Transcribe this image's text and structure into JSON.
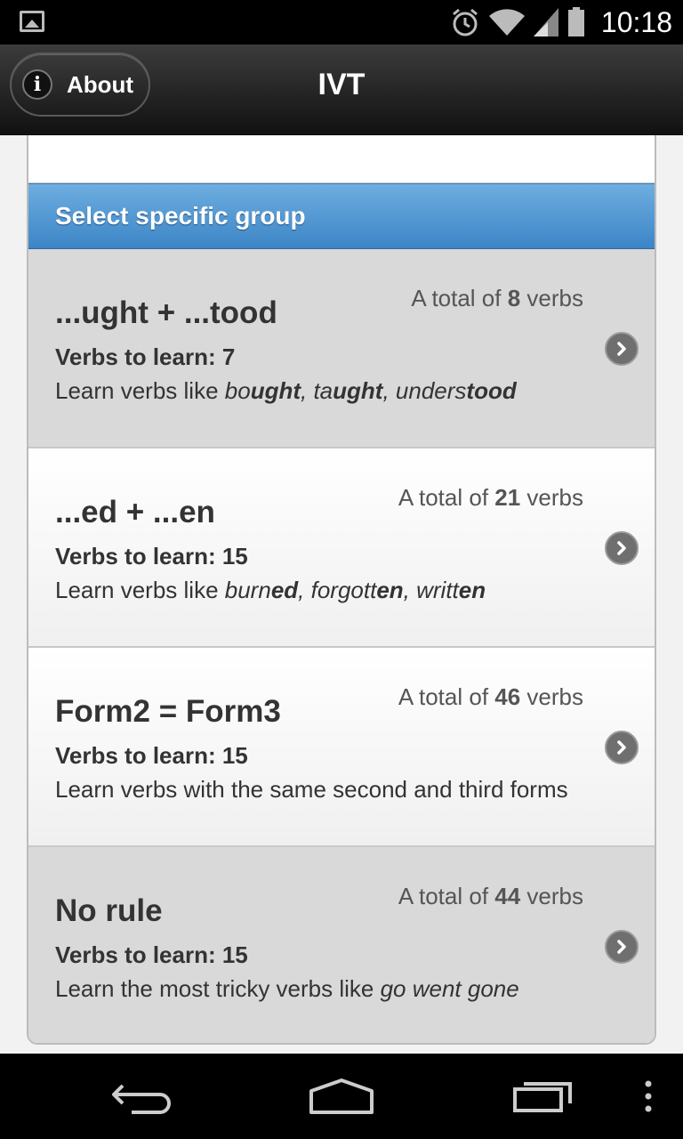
{
  "status_bar": {
    "time": "10:18",
    "icons": [
      "gallery-icon",
      "alarm-icon",
      "wifi-icon",
      "signal-icon",
      "battery-icon"
    ]
  },
  "header": {
    "about_label": "About",
    "about_icon": "info-icon",
    "title": "IVT"
  },
  "list": {
    "divider_label": "Select specific group",
    "items": [
      {
        "count_prefix": "A total of ",
        "count": "8",
        "count_suffix": " verbs",
        "title": "...ught + ...tood",
        "learn": "Verbs to learn: 7",
        "desc_prefix": "Learn verbs like ",
        "examples": [
          {
            "stem": "bo",
            "ending": "ught",
            "sep": ", "
          },
          {
            "stem": "ta",
            "ending": "ught",
            "sep": ", "
          },
          {
            "stem": "unders",
            "ending": "tood",
            "sep": ""
          }
        ],
        "style": "gray"
      },
      {
        "count_prefix": "A total of ",
        "count": "21",
        "count_suffix": " verbs",
        "title": "...ed + ...en",
        "learn": "Verbs to learn: 15",
        "desc_prefix": "Learn verbs like ",
        "examples": [
          {
            "stem": "burn",
            "ending": "ed",
            "sep": ", "
          },
          {
            "stem": "forgott",
            "ending": "en",
            "sep": ", "
          },
          {
            "stem": "writt",
            "ending": "en",
            "sep": ""
          }
        ],
        "style": "white"
      },
      {
        "count_prefix": "A total of ",
        "count": "46",
        "count_suffix": " verbs",
        "title": "Form2 = Form3",
        "learn": "Verbs to learn: 15",
        "desc_prefix": "Learn verbs with the same second and third forms",
        "examples": [],
        "style": "white"
      },
      {
        "count_prefix": "A total of ",
        "count": "44",
        "count_suffix": " verbs",
        "title": "No rule",
        "learn": "Verbs to learn: 15",
        "desc_prefix": "Learn the most tricky verbs like ",
        "desc_italic": "go went gone",
        "examples": [],
        "style": "gray"
      }
    ]
  },
  "nav_bar": {
    "buttons": [
      "back-icon",
      "home-icon",
      "recent-apps-icon",
      "overflow-menu-icon"
    ]
  },
  "colors": {
    "divider_top": "#6eaee0",
    "divider_bottom": "#3c85c6",
    "header_top": "#3c3c3c",
    "header_bottom": "#111111",
    "item_gray": "#d9d9d9"
  }
}
